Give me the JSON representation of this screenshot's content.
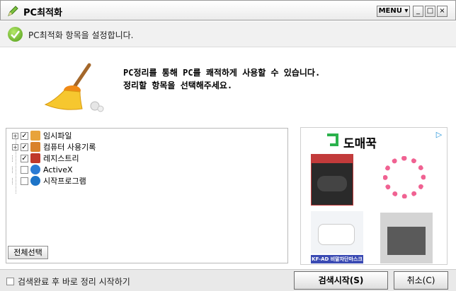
{
  "window": {
    "title": "PC최적화",
    "menu_label": "MENU",
    "minimize_symbol": "_",
    "maximize_symbol": "□",
    "close_symbol": "×"
  },
  "status": {
    "message": "PC최적화 항목을 설정합니다."
  },
  "intro": {
    "line1": "PC정리를 통해 PC를 쾌적하게 사용할 수 있습니다.",
    "line2": "정리할 항목을 선택해주세요."
  },
  "tree": {
    "items": [
      {
        "label": "임시파일",
        "checked": true,
        "expandable": true,
        "icon": "folder-icon",
        "color": "#e8a33a"
      },
      {
        "label": "컴퓨터 사용기록",
        "checked": true,
        "expandable": true,
        "icon": "history-icon",
        "color": "#d9822b"
      },
      {
        "label": "레지스트리",
        "checked": true,
        "expandable": false,
        "icon": "registry-icon",
        "color": "#c0392b"
      },
      {
        "label": "ActiveX",
        "checked": false,
        "expandable": false,
        "icon": "activex-icon",
        "color": "#2a7bd4"
      },
      {
        "label": "시작프로그램",
        "checked": false,
        "expandable": false,
        "icon": "power-icon",
        "color": "#1d74c8"
      }
    ],
    "select_all_label": "전체선택"
  },
  "ad": {
    "brand": "도매꾹",
    "product_caption": "KF-AD 비말차단마스크"
  },
  "footer": {
    "auto_start_label": "검색완료 후 바로 정리 시작하기",
    "auto_start_checked": false,
    "start_button": "검색시작(S)",
    "cancel_button": "취소(C)"
  }
}
